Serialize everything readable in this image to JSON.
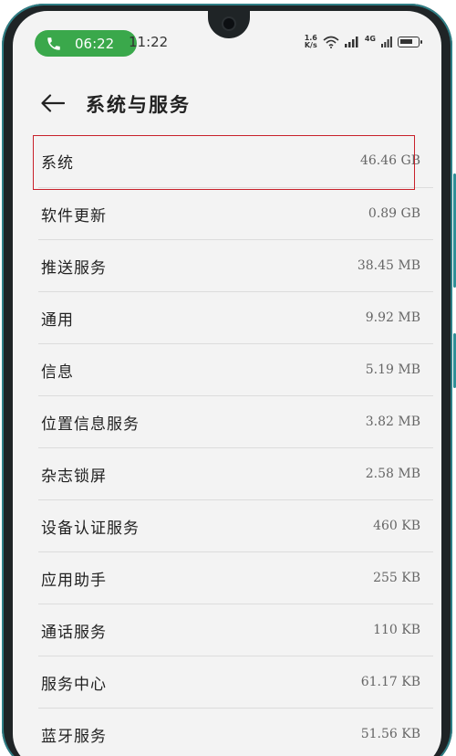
{
  "status_bar": {
    "call_time": "06:22",
    "clock": "11:22",
    "net_speed_value": "1.6",
    "net_speed_unit": "K/s",
    "network_type": "4G"
  },
  "header": {
    "title": "系统与服务"
  },
  "items": [
    {
      "label": "系统",
      "size": "46.46 GB"
    },
    {
      "label": "软件更新",
      "size": "0.89 GB"
    },
    {
      "label": "推送服务",
      "size": "38.45 MB"
    },
    {
      "label": "通用",
      "size": "9.92 MB"
    },
    {
      "label": "信息",
      "size": "5.19 MB"
    },
    {
      "label": "位置信息服务",
      "size": "3.82 MB"
    },
    {
      "label": "杂志锁屏",
      "size": "2.58 MB"
    },
    {
      "label": "设备认证服务",
      "size": "460 KB"
    },
    {
      "label": "应用助手",
      "size": "255 KB"
    },
    {
      "label": "通话服务",
      "size": "110 KB"
    },
    {
      "label": "服务中心",
      "size": "61.17 KB"
    },
    {
      "label": "蓝牙服务",
      "size": "51.56 KB"
    }
  ]
}
